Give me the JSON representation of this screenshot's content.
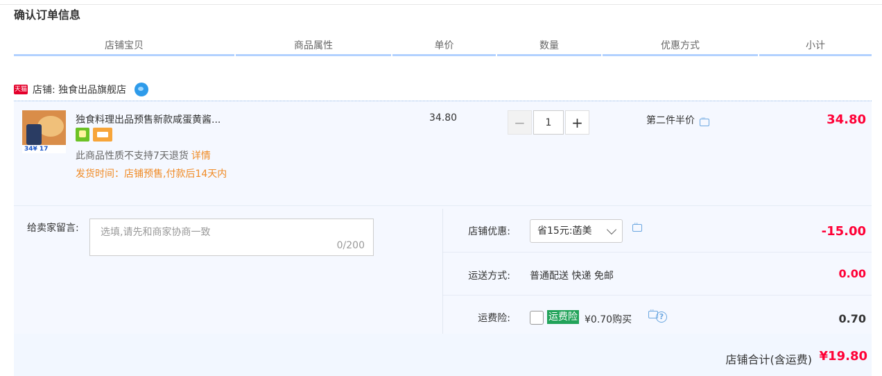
{
  "section_title": "确认订单信息",
  "columns": [
    "店铺宝贝",
    "商品属性",
    "单价",
    "数量",
    "优惠方式",
    "小计"
  ],
  "shop": {
    "badge": "天猫",
    "label": "店铺: 独食出品旗舰店"
  },
  "item": {
    "thumb_price_text": "34¥ 17",
    "title": "独食料理出品预售新款咸蛋黄酱...",
    "no_return_text": "此商品性质不支持7天退货",
    "detail_link": "详情",
    "ship_time": "发货时间：店铺预售,付款后14天内",
    "unit_price": "34.80",
    "quantity": "1",
    "minus": "−",
    "plus": "+",
    "promotion": "第二件半价",
    "subtotal": "34.80"
  },
  "message": {
    "label": "给卖家留言:",
    "placeholder": "选填,请先和商家协商一致",
    "count": "0/200"
  },
  "shop_discount": {
    "label": "店铺优惠:",
    "selected": "省15元:菡美",
    "value": "-15.00"
  },
  "shipping": {
    "label": "运送方式:",
    "method": "普通配送 快递 免邮",
    "value": "0.00"
  },
  "insurance": {
    "label": "运费险:",
    "tag": "运费险",
    "price_text": "¥0.70购买",
    "help": "?",
    "value": "0.70"
  },
  "total": {
    "label": "店铺合计(含运费)",
    "value": "¥19.80"
  },
  "colors": {
    "accent_red": "#ff0036",
    "orange": "#f08a24",
    "header_border": "#b2d1ff",
    "panel_bg": "#f5f8ff",
    "insurance_green": "#22a35a"
  }
}
